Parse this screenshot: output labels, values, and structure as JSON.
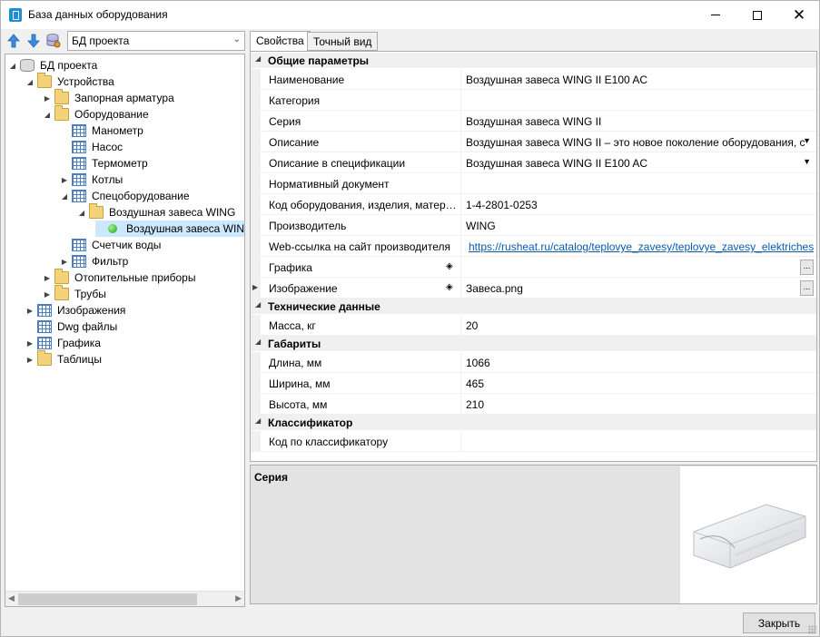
{
  "window": {
    "title": "База данных оборудования",
    "controls": {
      "minimize": "minimize-icon",
      "maximize": "maximize-icon",
      "close": "close-icon"
    }
  },
  "toolbar": {
    "icons": [
      "arrow-up-icon",
      "arrow-down-icon",
      "database-settings-icon"
    ],
    "db_select": "БД проекта"
  },
  "tree": {
    "items": [
      {
        "label": "БД проекта",
        "level": 0,
        "expanded": true,
        "icon": "database-icon"
      },
      {
        "label": "Устройства",
        "level": 1,
        "expanded": true,
        "icon": "folder-icon"
      },
      {
        "label": "Запорная арматура",
        "level": 2,
        "expanded": false,
        "icon": "folder-icon"
      },
      {
        "label": "Оборудование",
        "level": 2,
        "expanded": true,
        "icon": "folder-icon"
      },
      {
        "label": "Манометр",
        "level": 3,
        "icon": "table-icon"
      },
      {
        "label": "Насос",
        "level": 3,
        "icon": "table-icon"
      },
      {
        "label": "Термометр",
        "level": 3,
        "icon": "table-icon"
      },
      {
        "label": "Котлы",
        "level": 3,
        "expanded": false,
        "icon": "table-icon"
      },
      {
        "label": "Спецоборудование",
        "level": 3,
        "expanded": true,
        "icon": "table-icon"
      },
      {
        "label": "Воздушная завеса WING",
        "level": 4,
        "expanded": true,
        "icon": "folder-icon"
      },
      {
        "label": "Воздушная завеса WIN",
        "level": 5,
        "icon": "green-bullet-icon",
        "selected": true
      },
      {
        "label": "Счетчик воды",
        "level": 3,
        "icon": "table-icon"
      },
      {
        "label": "Фильтр",
        "level": 3,
        "expanded": false,
        "icon": "table-icon"
      },
      {
        "label": "Отопительные приборы",
        "level": 2,
        "expanded": false,
        "icon": "folder-icon"
      },
      {
        "label": "Трубы",
        "level": 2,
        "expanded": false,
        "icon": "folder-icon"
      },
      {
        "label": "Изображения",
        "level": 1,
        "expanded": false,
        "icon": "table-icon"
      },
      {
        "label": "Dwg файлы",
        "level": 1,
        "icon": "table-icon"
      },
      {
        "label": "Графика",
        "level": 1,
        "expanded": false,
        "icon": "table-icon"
      },
      {
        "label": "Таблицы",
        "level": 1,
        "expanded": false,
        "icon": "folder-icon"
      }
    ]
  },
  "tabs": [
    {
      "label": "Свойства",
      "active": true
    },
    {
      "label": "Точный вид",
      "active": false
    }
  ],
  "properties": {
    "general": {
      "title": "Общие параметры",
      "rows": [
        {
          "name": "Наименование",
          "value": "Воздушная завеса WING II E100 AC"
        },
        {
          "name": "Категория",
          "value": ""
        },
        {
          "name": "Серия",
          "value": "Воздушная завеса WING  II"
        },
        {
          "name": "Описание",
          "value": "Воздушная завеса WING II – это новое поколение оборудования, с",
          "dropdown": true
        },
        {
          "name": "Описание в спецификации",
          "value": "Воздушная завеса WING II E100 AC",
          "dropdown": true
        },
        {
          "name": "Нормативный документ",
          "value": ""
        },
        {
          "name": "Код оборудования, изделия, матери…",
          "value": "1-4-2801-0253"
        },
        {
          "name": "Производитель",
          "value": "WING"
        },
        {
          "name": "Web-ссылка на сайт производителя",
          "value": "https://rusheat.ru/catalog/teplovye_zavesy/teplovye_zavesy_elektricheski",
          "link": true
        },
        {
          "name": "Графика",
          "value": "",
          "diamond": true,
          "ellipsis": "..."
        },
        {
          "name": "Изображение",
          "value": "Завеса.png",
          "diamond": true,
          "ellipsis": "...",
          "expandable": true
        }
      ]
    },
    "technical": {
      "title": "Технические данные",
      "rows": [
        {
          "name": "Масса, кг",
          "value": "20"
        }
      ]
    },
    "dimensions": {
      "title": "Габариты",
      "rows": [
        {
          "name": "Длина, мм",
          "value": "1066"
        },
        {
          "name": "Ширина, мм",
          "value": "465"
        },
        {
          "name": "Высота, мм",
          "value": "210"
        }
      ]
    },
    "classifier": {
      "title": "Классификатор",
      "rows": [
        {
          "name": "Код по классификатору",
          "value": ""
        }
      ]
    }
  },
  "description": {
    "title": "Серия",
    "image": "air-curtain-image"
  },
  "footer": {
    "close_label": "Закрыть"
  }
}
